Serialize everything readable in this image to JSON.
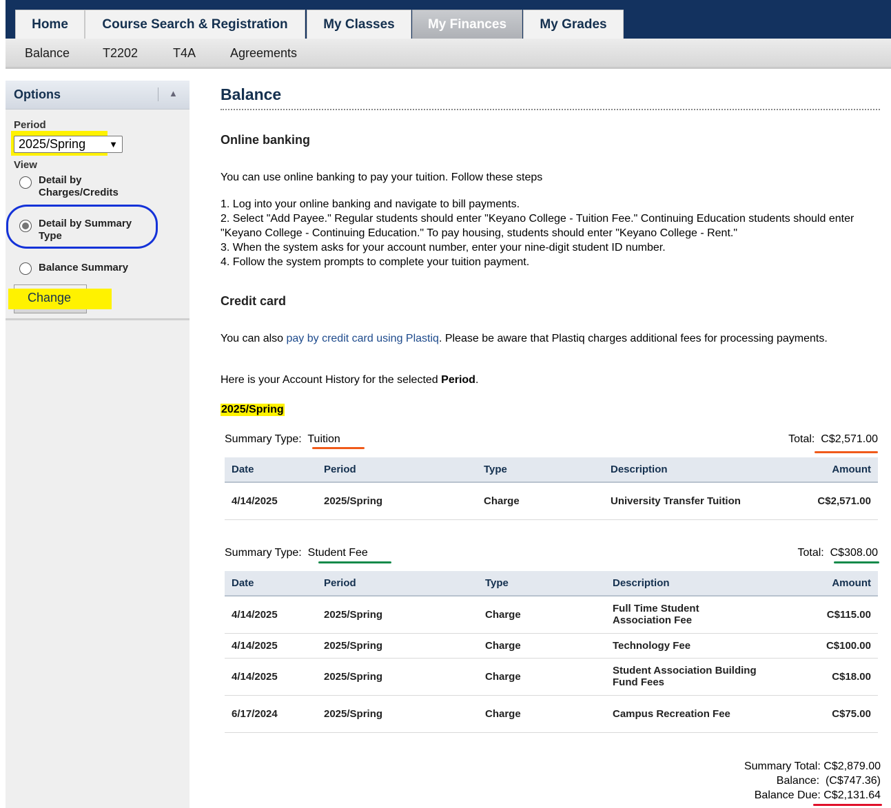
{
  "nav": {
    "tabs": [
      {
        "label": "Home"
      },
      {
        "label": "Course Search & Registration"
      },
      {
        "label": "My Classes"
      },
      {
        "label": "My Finances",
        "active": true
      },
      {
        "label": "My Grades"
      }
    ],
    "subnav": [
      "Balance",
      "T2202",
      "T4A",
      "Agreements"
    ]
  },
  "sidebar": {
    "title": "Options",
    "collapse_icon": "triangle-up-icon",
    "period_label": "Period",
    "period_value": "2025/Spring",
    "view_label": "View",
    "view_options": [
      {
        "label": "Detail by Charges/Credits",
        "checked": false
      },
      {
        "label": "Detail by Summary Type",
        "checked": true
      },
      {
        "label": "Balance Summary",
        "checked": false
      }
    ],
    "change_label": "Change"
  },
  "main": {
    "title": "Balance",
    "online_banking_heading": "Online banking",
    "online_banking_intro": "You can use online banking to pay your tuition. Follow these steps",
    "steps": [
      "1. Log into your online banking and navigate to bill payments.",
      "2. Select \"Add Payee.\" Regular students should enter \"Keyano College - Tuition Fee.\" Continuing Education students should enter \"Keyano College - Continuing Education.\" To pay housing, students should enter \"Keyano College - Rent.\"",
      "3. When the system asks for your account number, enter your nine-digit student ID number.",
      "4. Follow the system prompts to complete your tuition payment."
    ],
    "credit_card_heading": "Credit card",
    "credit_card_pre": "You can also ",
    "credit_card_link": "pay by credit card using Plastiq",
    "credit_card_post": ". Please be aware that Plastiq charges additional fees for processing payments.",
    "history_pre": "Here is your Account History for the selected ",
    "history_bold": "Period",
    "history_post": ".",
    "period_heading": "2025/Spring",
    "columns": [
      "Date",
      "Period",
      "Type",
      "Description",
      "Amount"
    ],
    "groups": [
      {
        "summary_label": "Summary Type:",
        "summary_type": "Tuition",
        "total_label": "Total:",
        "total_value": "C$2,571.00",
        "rows": [
          {
            "date": "4/14/2025",
            "period": "2025/Spring",
            "type": "Charge",
            "description": "University Transfer Tuition",
            "amount": "C$2,571.00"
          }
        ]
      },
      {
        "summary_label": "Summary Type:",
        "summary_type": "Student Fee",
        "total_label": "Total:",
        "total_value": "C$308.00",
        "rows": [
          {
            "date": "4/14/2025",
            "period": "2025/Spring",
            "type": "Charge",
            "description": "Full Time Student Association Fee",
            "amount": "C$115.00"
          },
          {
            "date": "4/14/2025",
            "period": "2025/Spring",
            "type": "Charge",
            "description": "Technology Fee",
            "amount": "C$100.00"
          },
          {
            "date": "4/14/2025",
            "period": "2025/Spring",
            "type": "Charge",
            "description": "Student Association Building Fund Fees",
            "amount": "C$18.00"
          },
          {
            "date": "6/17/2024",
            "period": "2025/Spring",
            "type": "Charge",
            "description": "Campus Recreation Fee",
            "amount": "C$75.00"
          }
        ]
      }
    ],
    "summary_total_label": "Summary Total:",
    "summary_total_value": "C$2,879.00",
    "balance_label": "Balance:",
    "balance_value": "(C$747.36)",
    "balance_due_label": "Balance Due:",
    "balance_due_value": "C$2,131.64"
  },
  "colors": {
    "navy": "#13325f",
    "highlight_yellow": "#fff200",
    "annotation_blue": "#1432d8",
    "annotation_orange": "#f05a1a",
    "annotation_green": "#138a4a",
    "annotation_red": "#e0102a"
  }
}
